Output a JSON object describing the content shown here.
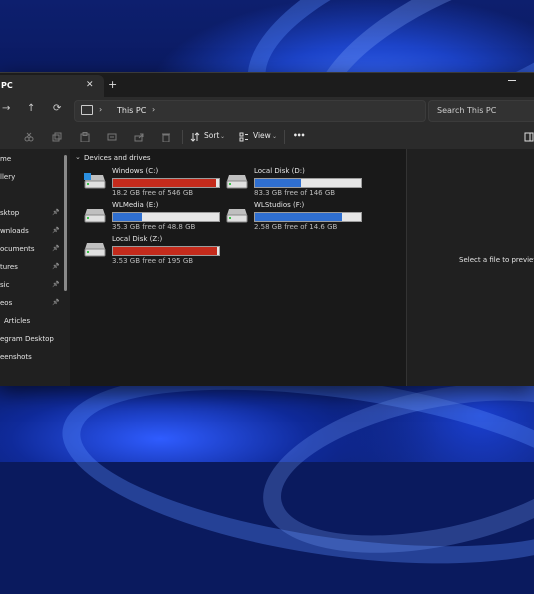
{
  "tab": {
    "title": "PC",
    "close": "✕",
    "new_tab": "+"
  },
  "nav": {
    "back": "←",
    "forward": "→",
    "up": "↑",
    "refresh": "⟳"
  },
  "address": {
    "separator": "›",
    "crumb": "This PC",
    "chevron": "›"
  },
  "search": {
    "placeholder": "Search This PC"
  },
  "toolbar": {
    "sort_label": "Sort",
    "view_label": "View",
    "more_label": "•••",
    "icons": [
      "cut-icon",
      "copy-icon",
      "paste-icon",
      "rename-icon",
      "share-icon",
      "delete-icon"
    ]
  },
  "sidebar": {
    "items": [
      {
        "label": "me",
        "pinned": false
      },
      {
        "label": "llery",
        "pinned": false
      },
      {
        "label": "sktop",
        "pinned": true
      },
      {
        "label": "wnloads",
        "pinned": true
      },
      {
        "label": "ocuments",
        "pinned": true
      },
      {
        "label": "tures",
        "pinned": true
      },
      {
        "label": "sic",
        "pinned": true
      },
      {
        "label": "eos",
        "pinned": true
      },
      {
        "label": "Articles",
        "pinned": false
      },
      {
        "label": "egram Desktop",
        "pinned": false
      },
      {
        "label": "eenshots",
        "pinned": false
      }
    ]
  },
  "content": {
    "group_label": "Devices and drives",
    "drives": [
      {
        "name": "Windows (C:)",
        "free": "18.2 GB free of 546 GB",
        "used_fraction": 0.967,
        "color": "#c42b1c",
        "system": true
      },
      {
        "name": "Local Disk (D:)",
        "free": "83.3 GB free of 146 GB",
        "used_fraction": 0.43,
        "color": "#2f6fd0",
        "system": false
      },
      {
        "name": "WLMedia (E:)",
        "free": "35.3 GB free of 48.8 GB",
        "used_fraction": 0.277,
        "color": "#2f6fd0",
        "system": false
      },
      {
        "name": "WLStudios (F:)",
        "free": "2.58 GB free of 14.6 GB",
        "used_fraction": 0.823,
        "color": "#2f6fd0",
        "system": false
      },
      {
        "name": "Local Disk (Z:)",
        "free": "3.53 GB free of 195 GB",
        "used_fraction": 0.982,
        "color": "#c42b1c",
        "system": false
      }
    ]
  },
  "preview": {
    "message": "Select a file to preview."
  }
}
